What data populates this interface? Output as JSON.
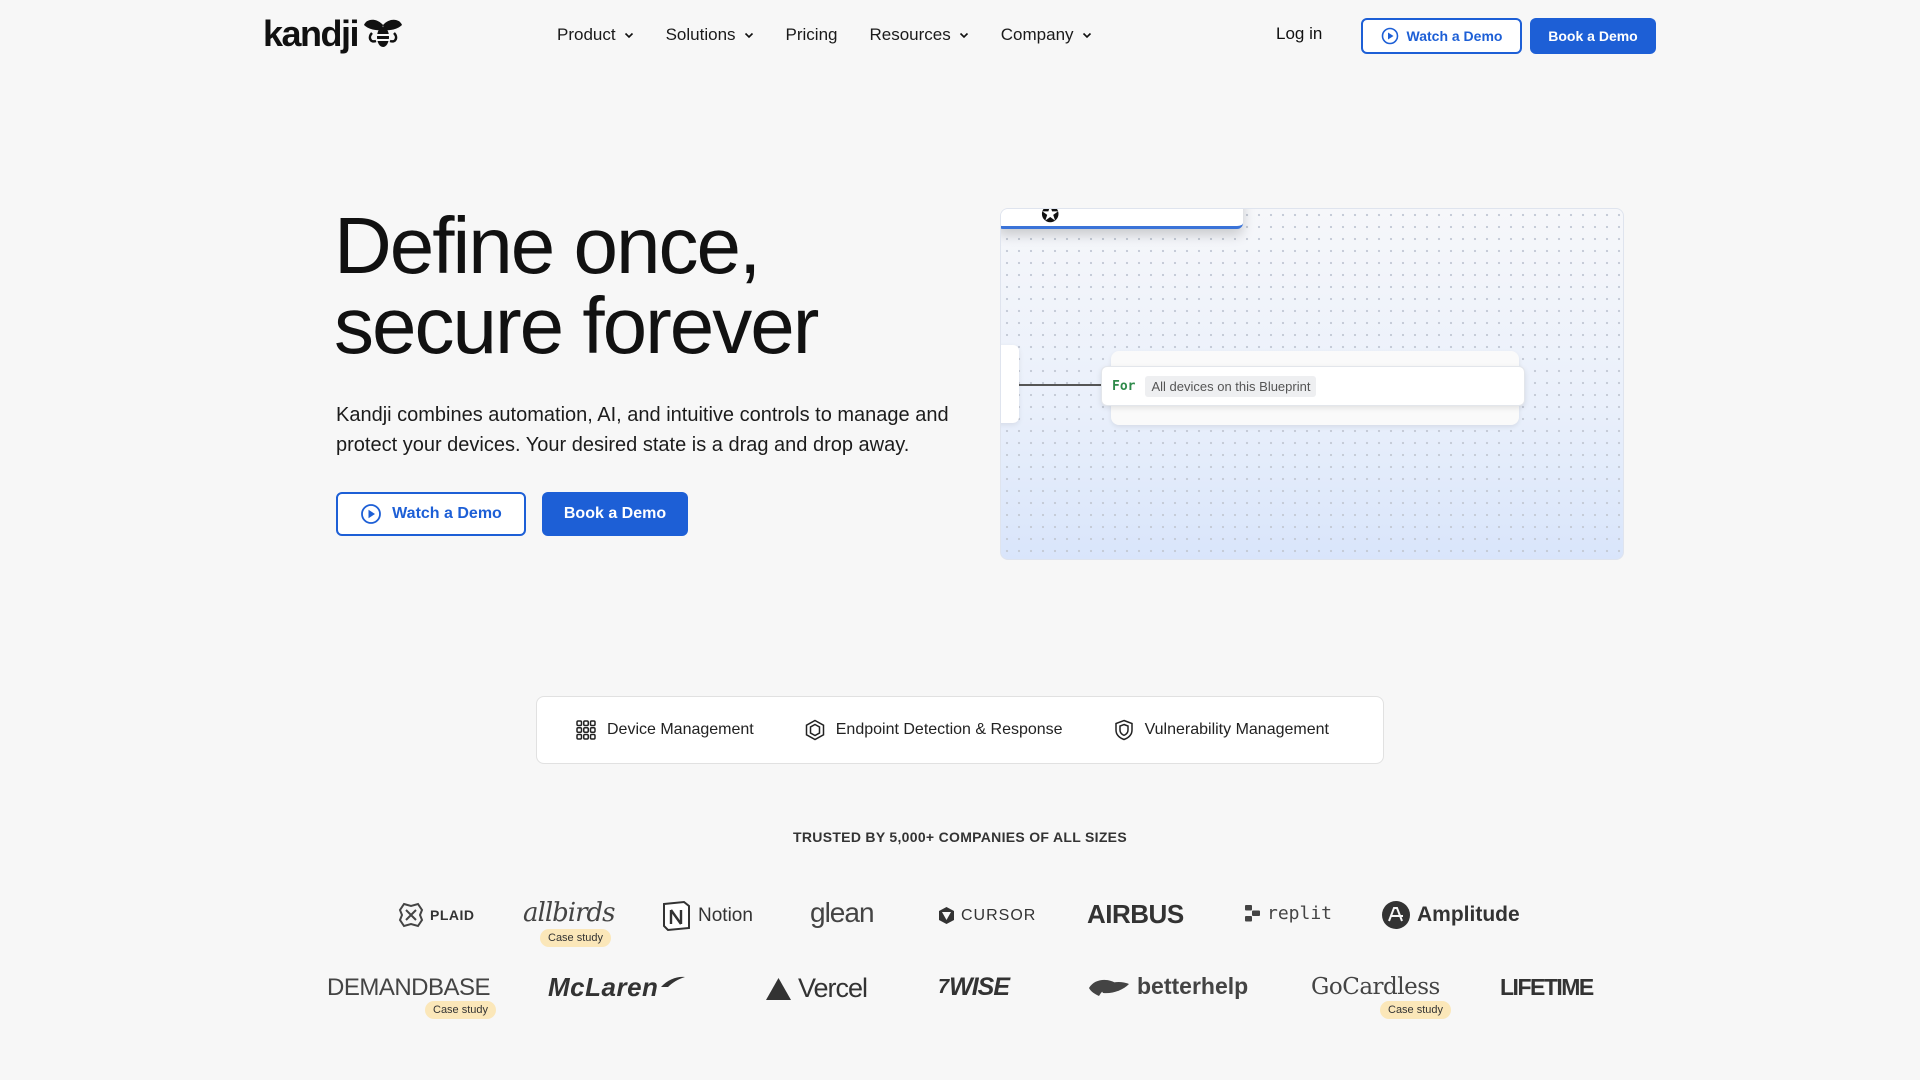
{
  "nav": {
    "logo": "kandji",
    "links": [
      {
        "label": "Product",
        "dropdown": true
      },
      {
        "label": "Solutions",
        "dropdown": true
      },
      {
        "label": "Pricing",
        "dropdown": false
      },
      {
        "label": "Resources",
        "dropdown": true
      },
      {
        "label": "Company",
        "dropdown": true
      }
    ],
    "login": "Log in",
    "watch_demo": "Watch a Demo",
    "book_demo": "Book a Demo"
  },
  "hero": {
    "title_line1": "Define once,",
    "title_line2": "secure forever",
    "subtitle": "Kandji combines automation, AI, and intuitive controls to manage and protect your devices. Your desired state is a drag and drop away.",
    "watch_demo": "Watch a Demo",
    "book_demo": "Book a Demo"
  },
  "panel": {
    "for_label": "For",
    "scope_tag": "All devices on this Blueprint"
  },
  "tabs": [
    {
      "label": "Device Management",
      "icon": "grid-icon"
    },
    {
      "label": "Endpoint Detection & Response",
      "icon": "hexagon-icon"
    },
    {
      "label": "Vulnerability Management",
      "icon": "shield-icon"
    }
  ],
  "trusted": {
    "heading": "TRUSTED BY 5,000+ COMPANIES OF ALL SIZES",
    "case_study_label": "Case study",
    "row1": [
      "PLAID",
      "allbirds",
      "Notion",
      "glean",
      "CURSOR",
      "AIRBUS",
      "replit",
      "Amplitude"
    ],
    "row2": [
      "DEMANDBASE",
      "McLaren",
      "Vercel",
      "WISE",
      "betterhelp",
      "GoCardless",
      "LIFETIME"
    ]
  },
  "colors": {
    "accent": "#1d5fd6",
    "background": "#f7f7f7",
    "badge": "#fbe7b9",
    "for_label": "#2e8a4a"
  }
}
